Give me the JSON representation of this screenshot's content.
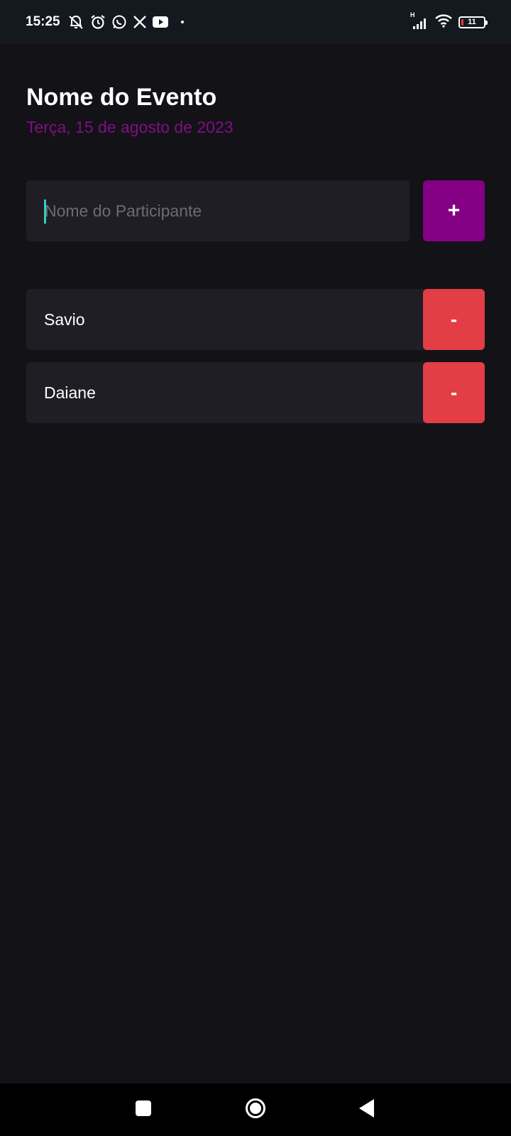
{
  "status_bar": {
    "time": "15:25",
    "notification_icons": [
      "muted-bell-icon",
      "alarm-icon",
      "whatsapp-icon",
      "x-icon",
      "youtube-icon"
    ],
    "network_label": "H",
    "battery_level": "11"
  },
  "event": {
    "title": "Nome do Evento",
    "date": "Terça, 15 de agosto de 2023"
  },
  "form": {
    "placeholder": "Nome do Participante",
    "add_label": "+"
  },
  "participants": [
    {
      "name": "Savio",
      "remove_label": "-"
    },
    {
      "name": "Daiane",
      "remove_label": "-"
    }
  ],
  "colors": {
    "background": "#131217",
    "surface": "#1F1E25",
    "accent_purple": "#830084",
    "date_purple": "#7F0F84",
    "remove_red": "#E33D45",
    "caret": "#31CFC0"
  },
  "nav_bar": {
    "buttons": [
      "recents-icon",
      "home-icon",
      "back-icon"
    ]
  }
}
